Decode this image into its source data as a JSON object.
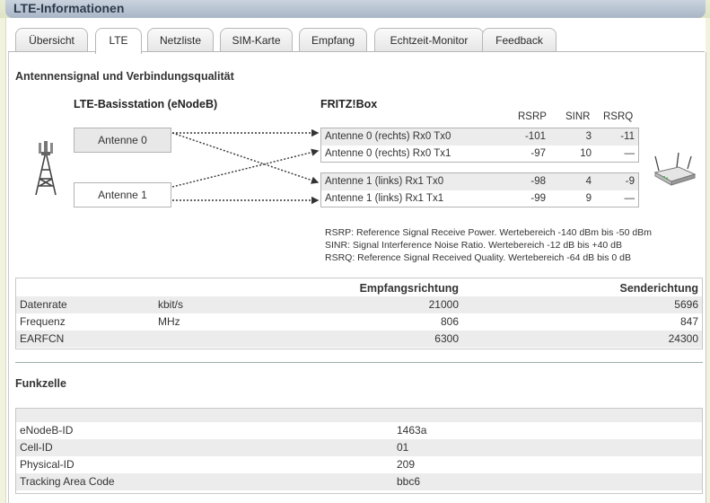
{
  "window": {
    "title": "LTE-Informationen"
  },
  "tabs": [
    {
      "label": "Übersicht",
      "active": false
    },
    {
      "label": "LTE",
      "active": true
    },
    {
      "label": "Netzliste",
      "active": false
    },
    {
      "label": "SIM-Karte",
      "active": false
    },
    {
      "label": "Empfang",
      "active": false
    },
    {
      "label": "Echtzeit-Monitor",
      "active": false
    },
    {
      "label": "Feedback",
      "active": false
    }
  ],
  "signal": {
    "heading": "Antennensignal und Verbindungsqualität",
    "base_station_label": "LTE-Basisstation (eNodeB)",
    "fritzbox_label": "FRITZ!Box",
    "antennas": [
      "Antenne 0",
      "Antenne 1"
    ],
    "col_headers": [
      "RSRP",
      "SINR",
      "RSRQ"
    ],
    "groups": [
      {
        "rows": [
          {
            "name": "Antenne 0 (rechts) Rx0 Tx0",
            "rsrp": "-101",
            "sinr": "3",
            "rsrq": "-11"
          },
          {
            "name": "Antenne 0 (rechts) Rx0 Tx1",
            "rsrp": "-97",
            "sinr": "10",
            "rsrq": "—"
          }
        ]
      },
      {
        "rows": [
          {
            "name": "Antenne 1 (links) Rx1 Tx0",
            "rsrp": "-98",
            "sinr": "4",
            "rsrq": "-9"
          },
          {
            "name": "Antenne 1 (links) Rx1 Tx1",
            "rsrp": "-99",
            "sinr": "9",
            "rsrq": "—"
          }
        ]
      }
    ],
    "notes": [
      "RSRP: Reference Signal Receive Power. Wertebereich -140 dBm bis -50 dBm",
      "SINR: Signal Interference Noise Ratio. Wertebereich -12 dB bis +40 dB",
      "RSRQ: Reference Signal Received Quality. Wertebereich -64 dB bis 0 dB"
    ]
  },
  "rates": {
    "headers": [
      "Empfangsrichtung",
      "Senderichtung"
    ],
    "rows": [
      {
        "label": "Datenrate",
        "unit": "kbit/s",
        "rx": "21000",
        "tx": "5696"
      },
      {
        "label": "Frequenz",
        "unit": "MHz",
        "rx": "806",
        "tx": "847"
      },
      {
        "label": "EARFCN",
        "unit": "",
        "rx": "6300",
        "tx": "24300"
      }
    ]
  },
  "cell": {
    "heading": "Funkzelle",
    "rows": [
      {
        "label": "eNodeB-ID",
        "value": "1463a"
      },
      {
        "label": "Cell-ID",
        "value": "01"
      },
      {
        "label": "Physical-ID",
        "value": "209"
      },
      {
        "label": "Tracking Area Code",
        "value": "bbc6"
      }
    ]
  },
  "colors": {
    "title_bar": "#b4c0cf",
    "frame": "#eef0d8",
    "row_alt": "#ececec",
    "border": "#b3b3b3"
  },
  "icons": {
    "tower": "cell-tower-icon",
    "router": "router-icon"
  }
}
